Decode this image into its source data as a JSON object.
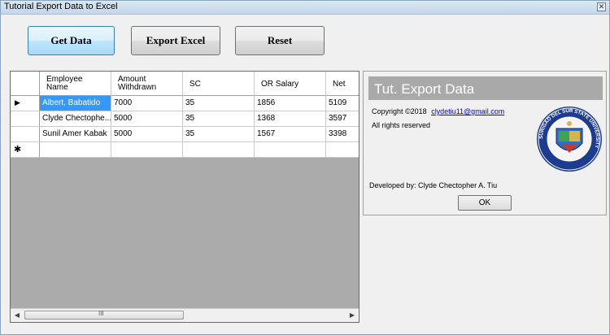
{
  "window": {
    "title": "Tutorial Export Data to Excel",
    "close_glyph": "✕"
  },
  "toolbar": {
    "get_data": "Get Data",
    "export_excel": "Export Excel",
    "reset": "Reset"
  },
  "grid": {
    "columns": [
      {
        "line1": "Employee",
        "line2": "Name"
      },
      {
        "line1": "Amount",
        "line2": "Withdrawn"
      },
      {
        "line1": "SC",
        "line2": ""
      },
      {
        "line1": "OR Salary",
        "line2": ""
      },
      {
        "line1": "Net",
        "line2": ""
      }
    ],
    "rows": [
      [
        "Albert, Babatido",
        "7000",
        "35",
        "1856",
        "5109"
      ],
      [
        "Clyde Chectophe...",
        "5000",
        "35",
        "1368",
        "3597"
      ],
      [
        "Sunil Amer Kabak",
        "5000",
        "35",
        "1567",
        "3398"
      ]
    ],
    "current_row_glyph": "▶",
    "new_row_glyph": "✱",
    "scroll_left_glyph": "◀",
    "scroll_right_glyph": "▶",
    "thumb_grip": "III"
  },
  "about": {
    "title": "Tut. Export Data",
    "copyright": "Copyright ©2018",
    "email": "clydetiu11@gmail.com",
    "rights": "All rights reserved",
    "developed": "Developed by: Clyde Chectopher A. Tiu",
    "ok": "OK",
    "seal_text": "SURIGAO DEL SUR STATE UNIVERSITY"
  },
  "colors": {
    "selection": "#3399ff",
    "grid_bg": "#ababab",
    "about_header": "#a9a9a9"
  }
}
